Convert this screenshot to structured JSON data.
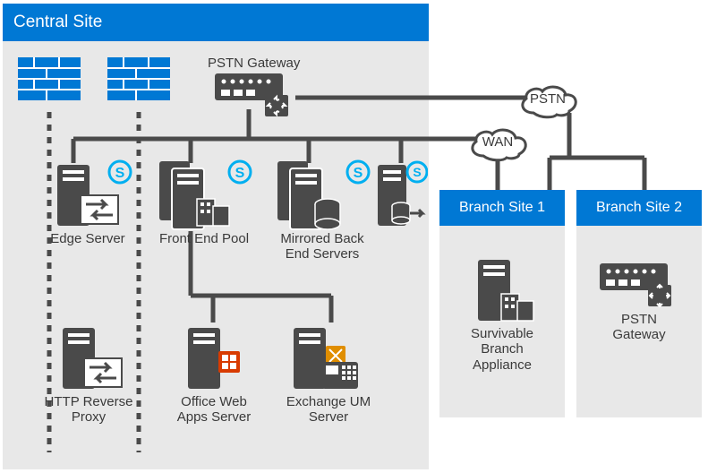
{
  "central": {
    "title": "Central Site"
  },
  "clouds": {
    "pstn": "PSTN",
    "wan": "WAN"
  },
  "nodes": {
    "pstn_gateway": "PSTN Gateway",
    "edge_server": "Edge Server",
    "front_end_pool": "Front End Pool",
    "mirrored_back_end": "Mirrored Back\nEnd Servers",
    "http_reverse_proxy": "HTTP Reverse\nProxy",
    "office_web_apps": "Office Web\nApps Server",
    "exchange_um": "Exchange UM\nServer"
  },
  "branch1": {
    "title": "Branch Site 1",
    "appliance": "Survivable\nBranch\nAppliance"
  },
  "branch2": {
    "title": "Branch Site 2",
    "gateway": "PSTN Gateway"
  }
}
